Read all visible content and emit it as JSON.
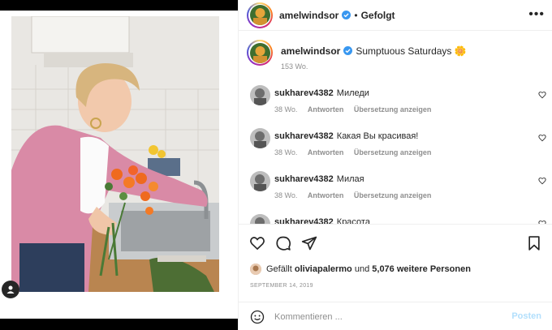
{
  "colors": {
    "accent": "#0095f6",
    "post_disabled": "#b2dffc",
    "muted": "#8e8e8e",
    "verified": "#3897f0"
  },
  "header": {
    "username": "amelwindsor",
    "separator": "•",
    "follow_status": "Gefolgt",
    "more_icon": "more-horizontal-icon"
  },
  "caption": {
    "username": "amelwindsor",
    "text": "Sumptuous Saturdays",
    "emoji": "🌼",
    "time": "153 Wo."
  },
  "comments": [
    {
      "username": "sukharev4382",
      "text": "Миледи",
      "time": "38 Wo.",
      "reply": "Antworten",
      "translate": "Übersetzung anzeigen"
    },
    {
      "username": "sukharev4382",
      "text": "Какая Вы красивая!",
      "time": "38 Wo.",
      "reply": "Antworten",
      "translate": "Übersetzung anzeigen"
    },
    {
      "username": "sukharev4382",
      "text": "Милая",
      "time": "38 Wo.",
      "reply": "Antworten",
      "translate": "Übersetzung anzeigen"
    },
    {
      "username": "sukharev4382",
      "text": "Красота",
      "time": "",
      "reply": "",
      "translate": ""
    }
  ],
  "likes": {
    "prefix": "Gefällt",
    "user": "oliviapalermo",
    "middle": "und",
    "others": "5,076 weitere Personen"
  },
  "date": "SEPTEMBER 14, 2019",
  "add_comment": {
    "placeholder": "Kommentieren ...",
    "post_label": "Posten"
  }
}
